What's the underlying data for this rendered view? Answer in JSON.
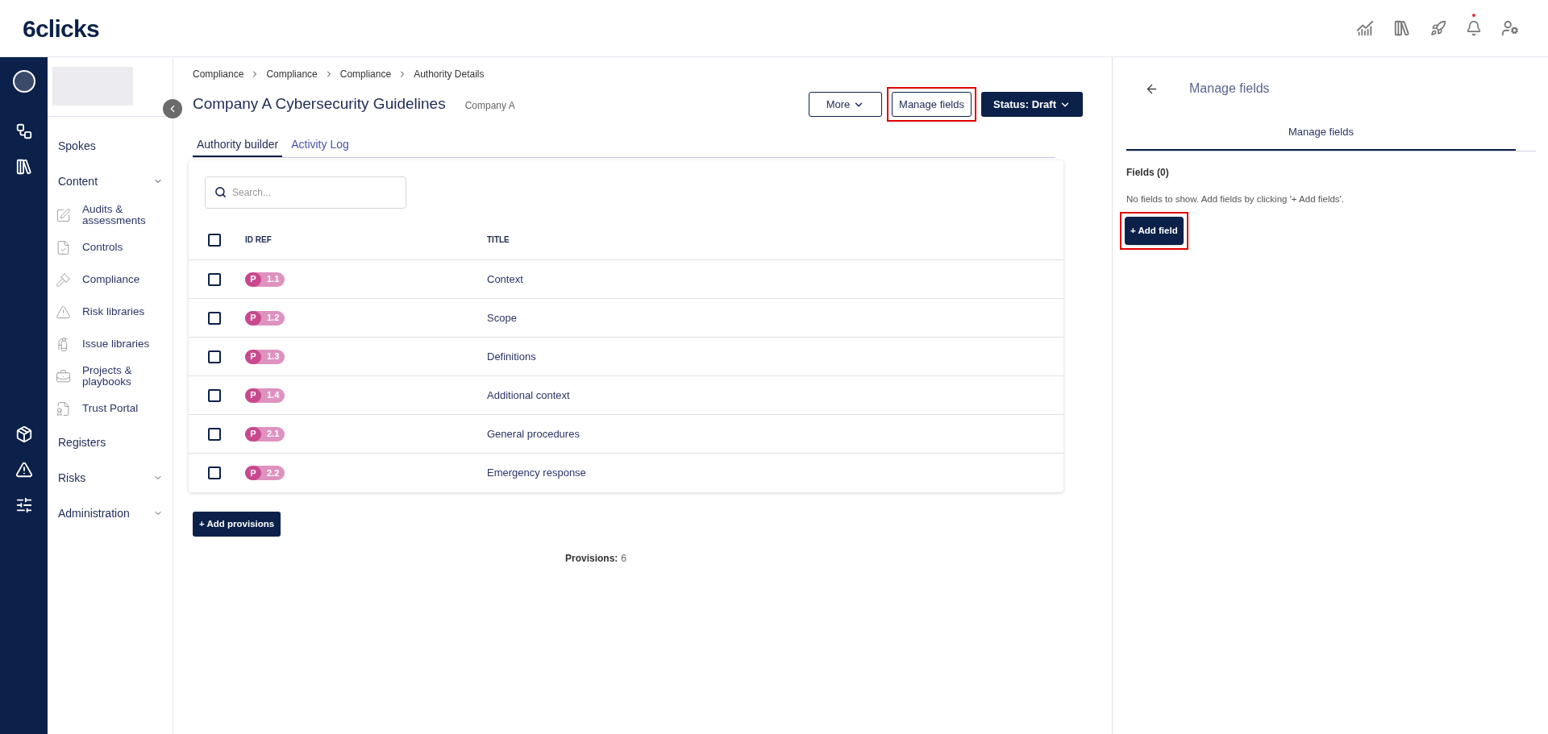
{
  "header": {
    "logo": "6clicks",
    "notification_dot": true
  },
  "sidebar": {
    "items": [
      {
        "label": "Spokes"
      },
      {
        "label": "Content",
        "expanded": true,
        "children": [
          {
            "label": "Audits & assessments"
          },
          {
            "label": "Controls"
          },
          {
            "label": "Compliance"
          },
          {
            "label": "Risk libraries"
          },
          {
            "label": "Issue libraries"
          },
          {
            "label": "Projects & playbooks"
          },
          {
            "label": "Trust Portal"
          }
        ]
      },
      {
        "label": "Registers"
      },
      {
        "label": "Risks",
        "expanded": false
      },
      {
        "label": "Administration",
        "expanded": false
      }
    ]
  },
  "breadcrumb": [
    "Compliance",
    "Compliance",
    "Compliance",
    "Authority Details"
  ],
  "page": {
    "title": "Company A Cybersecurity Guidelines",
    "subtitle": "Company A"
  },
  "actions": [
    {
      "label": "More",
      "kind": "menu",
      "highlighted": false
    },
    {
      "label": "Manage fields",
      "kind": "outline",
      "highlighted": true
    },
    {
      "label": "Status: Draft",
      "kind": "primary-menu",
      "highlighted": false
    }
  ],
  "tabs": [
    {
      "label": "Authority builder",
      "selected": true
    },
    {
      "label": "Activity Log",
      "selected": false
    }
  ],
  "search": {
    "placeholder": "Search..."
  },
  "table": {
    "columns": [
      "ID REF",
      "TITLE"
    ],
    "header_checked": false,
    "rows": [
      {
        "prefix": "P",
        "ref": "1.1",
        "title": "Context",
        "checked": false
      },
      {
        "prefix": "P",
        "ref": "1.2",
        "title": "Scope",
        "checked": false
      },
      {
        "prefix": "P",
        "ref": "1.3",
        "title": "Definitions",
        "checked": false
      },
      {
        "prefix": "P",
        "ref": "1.4",
        "title": "Additional context",
        "checked": false
      },
      {
        "prefix": "P",
        "ref": "2.1",
        "title": "General procedures",
        "checked": false
      },
      {
        "prefix": "P",
        "ref": "2.2",
        "title": "Emergency response",
        "checked": false
      }
    ]
  },
  "add_button": {
    "label": "+ Add provisions"
  },
  "footer": {
    "label": "Provisions:",
    "value": "6"
  },
  "panel": {
    "title": "Manage fields",
    "tabs": [
      {
        "label": "Manage fields",
        "selected": true
      }
    ],
    "fields_heading": "Fields (0)",
    "empty_message": "No fields to show. Add fields by clicking '+ Add fields'.",
    "add_button": {
      "label": "+ Add field",
      "highlighted": true
    }
  }
}
